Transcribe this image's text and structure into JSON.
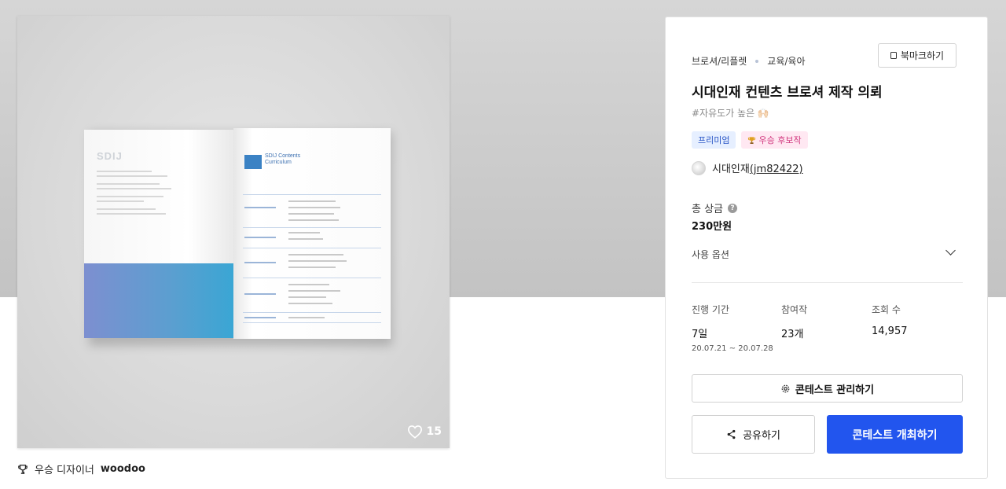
{
  "image_card": {
    "like_count": "15",
    "book": {
      "left_title": "SDIJ",
      "right_heading_1": "SDIJ Contents",
      "right_heading_2": "Curriculum"
    }
  },
  "designer": {
    "label": "우승 디자이너",
    "name": "woodoo"
  },
  "panel": {
    "breadcrumb": [
      "브로셔/리플렛",
      "교육/육아"
    ],
    "bookmark_label": "북마크하기",
    "title": "시대인재 컨텐츠 브로셔 제작 의뢰",
    "tagline": "#자유도가 높은 🙌🏻",
    "badges": {
      "premium": "프리미엄",
      "winner": "우승 후보작"
    },
    "author": {
      "name": "시대인재",
      "handle": "(jm82422)"
    },
    "prize": {
      "label": "총 상금",
      "help": "?",
      "value": "230만원"
    },
    "usage_label": "사용 옵션",
    "stats": {
      "duration": {
        "label": "진행 기간",
        "value": "7일",
        "range": "20.07.21 ~ 20.07.28"
      },
      "participants": {
        "label": "참여작",
        "value": "23개"
      },
      "views": {
        "label": "조회 수",
        "value": "14,957"
      }
    },
    "manage_label": "콘테스트 관리하기",
    "share_label": "공유하기",
    "host_label": "콘테스트 개최하기"
  },
  "colors": {
    "primary": "#2255ee",
    "premium_badge": "#2a56c6",
    "winner_badge": "#d0367d"
  }
}
